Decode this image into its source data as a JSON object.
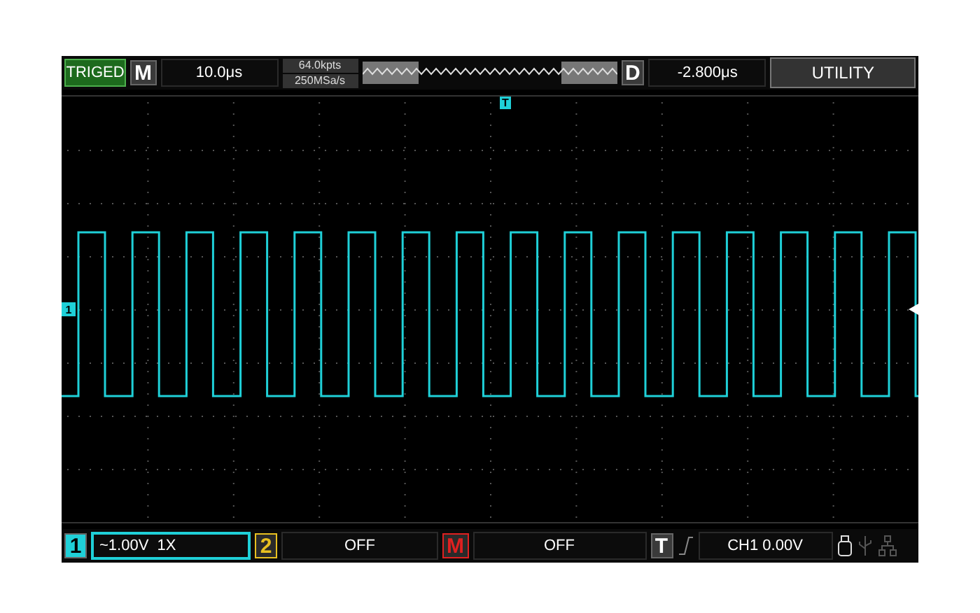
{
  "top_bar": {
    "trigger_status": "TRIGED",
    "mode_key": "M",
    "timebase": "10.0μs",
    "memory_depth": "64.0kpts",
    "sample_rate": "250MSa/s",
    "delay_key": "D",
    "delay": "-2.800μs",
    "menu": "UTILITY"
  },
  "markers": {
    "trigger_position": "T",
    "channel_ground": "1"
  },
  "bottom_bar": {
    "channels": [
      {
        "key": "1",
        "setting": "~1.00V  1X",
        "color": "#1fd0d8",
        "selected": true
      },
      {
        "key": "2",
        "setting": "OFF",
        "color": "#e8c020",
        "selected": false
      },
      {
        "key": "M",
        "setting": "OFF",
        "color": "#e02020",
        "selected": false
      }
    ],
    "trigger_key": "T",
    "trigger_setting": "CH1 0.00V"
  }
}
